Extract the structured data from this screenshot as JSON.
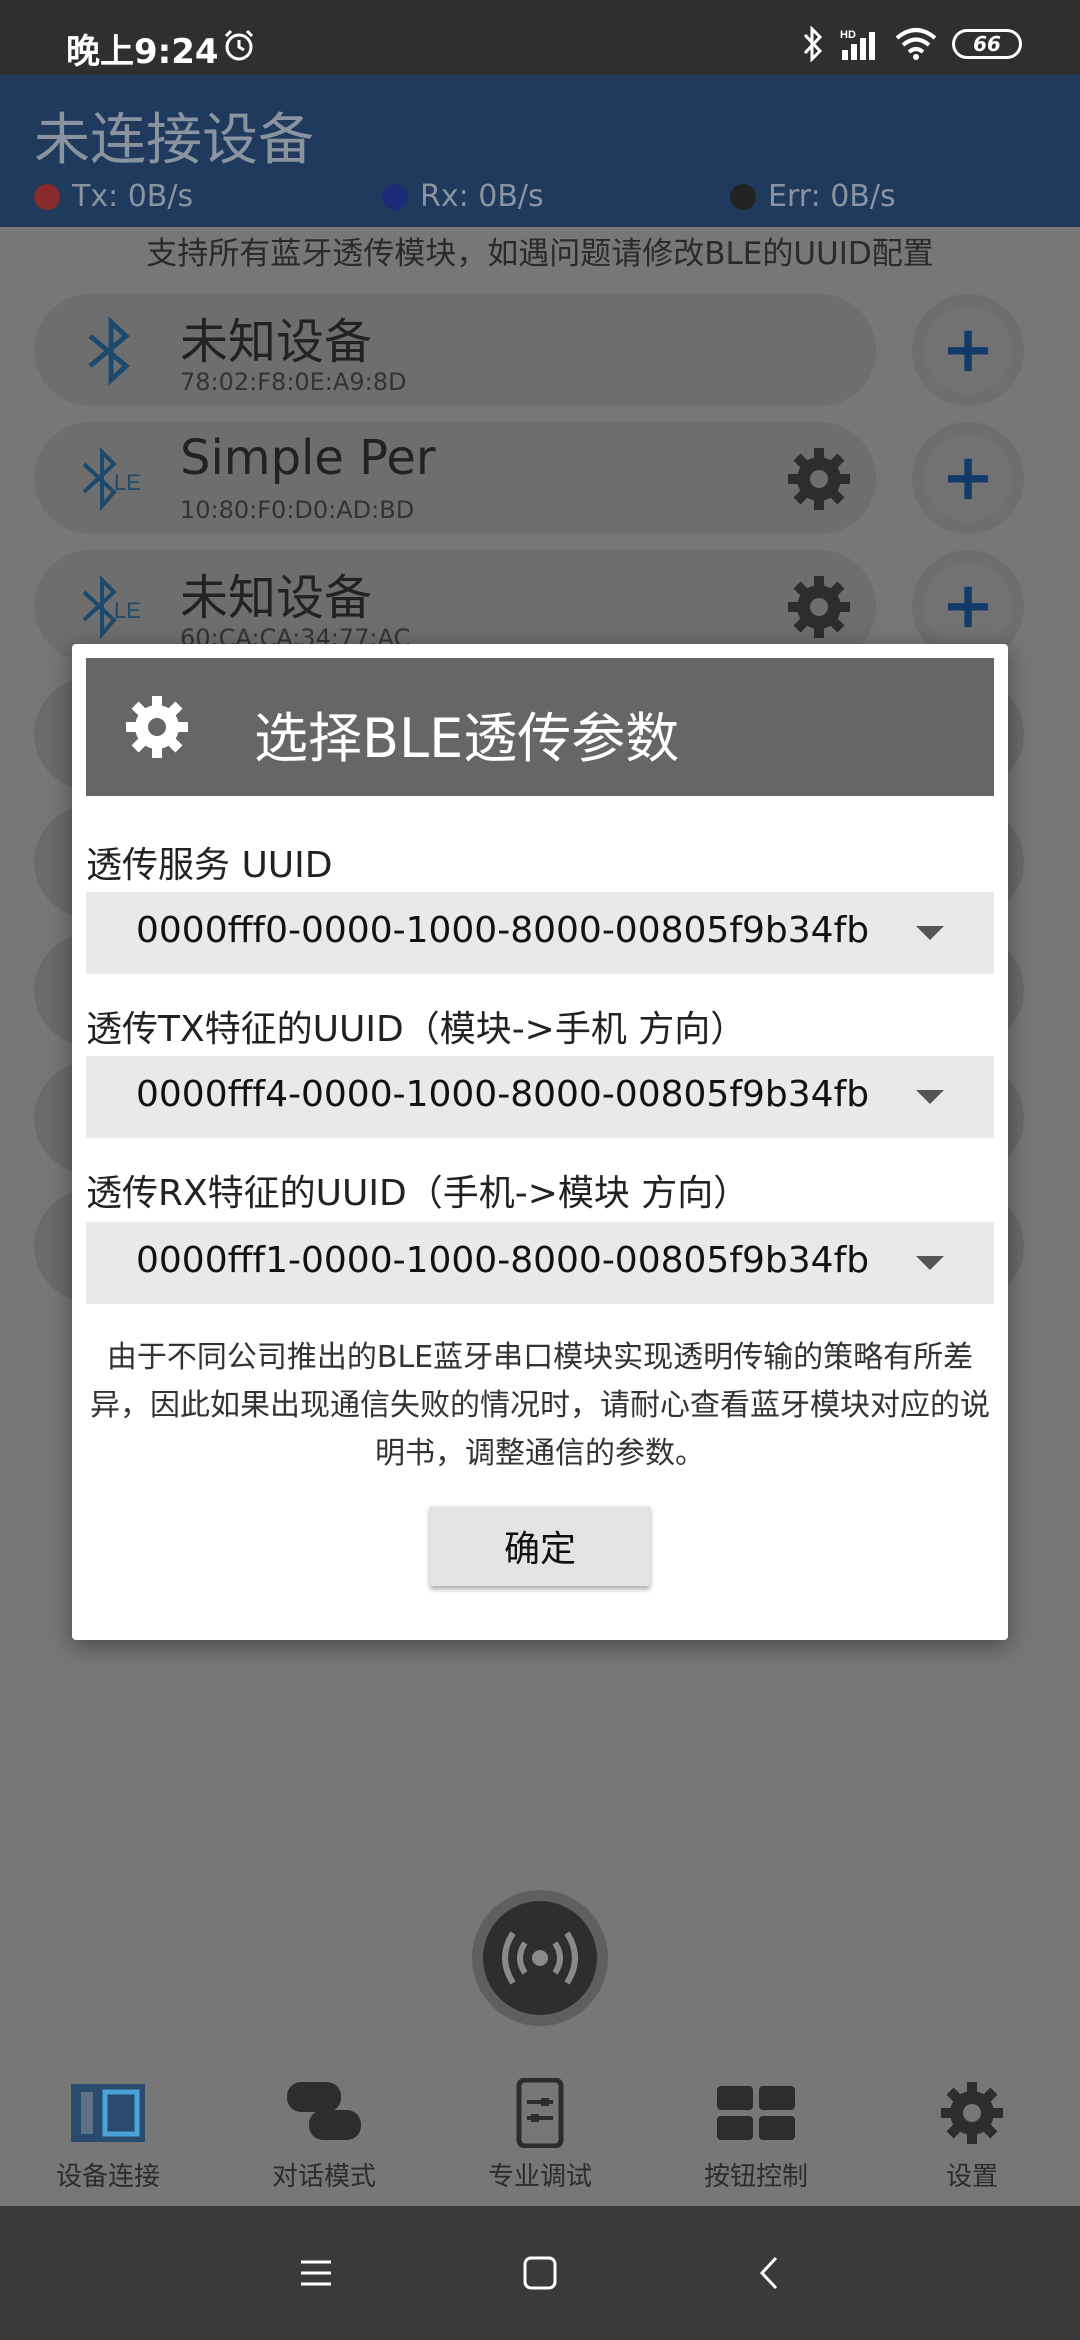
{
  "status_bar": {
    "time": "晚上9:24",
    "battery": "66",
    "network_label": "HD"
  },
  "header": {
    "title": "未连接设备",
    "tx": "Tx: 0B/s",
    "rx": "Rx: 0B/s",
    "err": "Err: 0B/s",
    "colors": {
      "tx": "#c0392b",
      "rx": "#2c3ea8",
      "err": "#2b2b2b"
    }
  },
  "hint": "支持所有蓝牙透传模块，如遇问题请修改BLE的UUID配置",
  "devices": [
    {
      "name": "未知设备",
      "mac": "78:02:F8:0E:A9:8D",
      "type": "bluetooth-icon"
    },
    {
      "name": "Simple Per",
      "mac": "10:80:F0:D0:AD:BD",
      "type": "bluetooth-le-icon"
    },
    {
      "name": "未知设备",
      "mac": "60:CA:CA:34:77:AC",
      "type": "bluetooth-le-icon"
    }
  ],
  "dialog": {
    "title": "选择BLE透传参数",
    "service_label": "透传服务 UUID",
    "service_value": "0000fff0-0000-1000-8000-00805f9b34fb",
    "tx_label": "透传TX特征的UUID（模块->手机 方向）",
    "tx_value": "0000fff4-0000-1000-8000-00805f9b34fb",
    "rx_label": "透传RX特征的UUID（手机->模块 方向）",
    "rx_value": "0000fff1-0000-1000-8000-00805f9b34fb",
    "note": "由于不同公司推出的BLE蓝牙串口模块实现透明传输的策略有所差异，因此如果出现通信失败的情况时，请耐心查看蓝牙模块对应的说明书，调整通信的参数。",
    "ok": "确定"
  },
  "bottom_nav": [
    {
      "label": "设备连接",
      "icon": "device-connect-icon"
    },
    {
      "label": "对话模式",
      "icon": "chat-icon"
    },
    {
      "label": "专业调试",
      "icon": "debug-icon"
    },
    {
      "label": "按钮控制",
      "icon": "button-grid-icon"
    },
    {
      "label": "设置",
      "icon": "gear-icon"
    }
  ]
}
